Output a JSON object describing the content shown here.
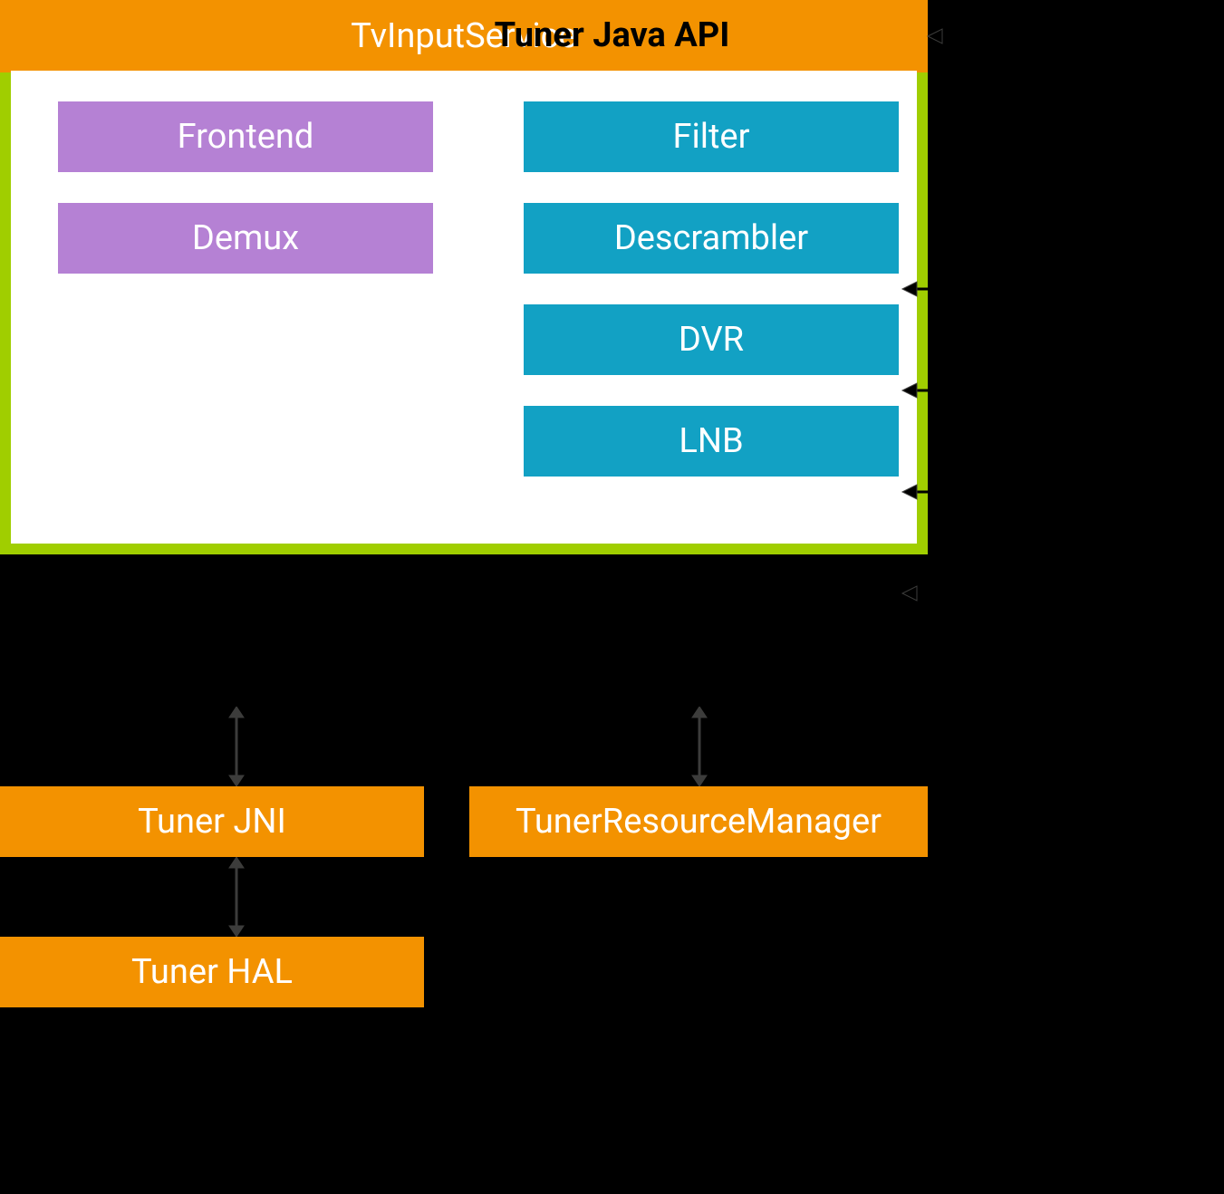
{
  "boxes": {
    "tvInputService": "TvInputService",
    "tunerJavaApi": "Tuner Java API",
    "frontend": "Frontend",
    "demux": "Demux",
    "filter": "Filter",
    "descrambler": "Descrambler",
    "dvr": "DVR",
    "lnb": "LNB",
    "tunerJni": "Tuner JNI",
    "tunerResourceManager": "TunerResourceManager",
    "tunerHal": "Tuner HAL"
  },
  "colors": {
    "orange": "#f39200",
    "green": "#a0ce00",
    "purple": "#b581d4",
    "blue": "#12a1c4",
    "arrow": "#3c3c3b"
  }
}
